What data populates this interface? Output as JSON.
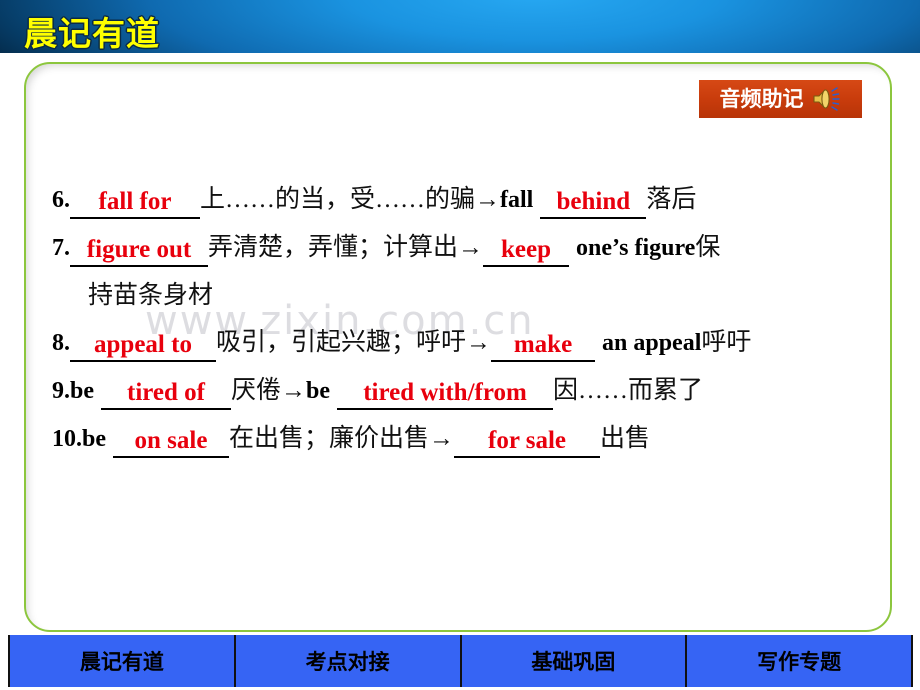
{
  "header": {
    "title": "晨记有道",
    "title_color": "#ffff00",
    "banner_color": "#0d5f9e"
  },
  "audio_button": {
    "label": "音频助记",
    "icon": "speaker-icon",
    "background_color": "#c93c0c",
    "text_color": "#ffffff"
  },
  "watermark": {
    "text": "www.zixin.com.cn"
  },
  "panel": {
    "border_color": "#8cc63e"
  },
  "entries": [
    {
      "number": "6.",
      "answer1": "fall for",
      "middle": "上……的当，受……的骗→",
      "lead2": "fall",
      "answer2": "behind",
      "tail": "落后"
    },
    {
      "number": "7.",
      "answer1": "figure out",
      "middle": "弄清楚，弄懂；计算出→",
      "answer2": "keep",
      "tail": "one’s figure",
      "tail_cn": "保",
      "wrap": "持苗条身材"
    },
    {
      "number": "8.",
      "answer1": "appeal to",
      "middle": "吸引，引起兴趣；呼吁→",
      "answer2": "make",
      "tail": "an appeal",
      "tail_cn": "呼吁"
    },
    {
      "number": "9.",
      "lead1": "be",
      "answer1": "tired of",
      "middle": "厌倦→",
      "lead2": "be",
      "answer2": "tired with/from",
      "tail_cn": "因……而累了"
    },
    {
      "number": "10.",
      "lead1": "be",
      "answer1": "on sale",
      "middle": "在出售；廉价出售→",
      "answer2": "for sale",
      "tail_cn": "出售"
    }
  ],
  "bottom_nav": {
    "background_color": "#3664f4",
    "tabs": [
      {
        "label": "晨记有道"
      },
      {
        "label": "考点对接"
      },
      {
        "label": "基础巩固"
      },
      {
        "label": "写作专题"
      }
    ]
  }
}
